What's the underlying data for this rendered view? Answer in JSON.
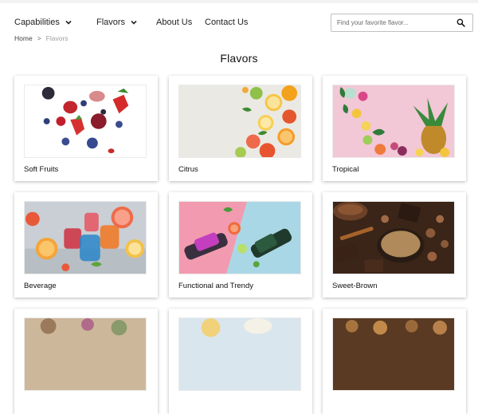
{
  "nav": {
    "capabilities": "Capabilities",
    "flavors": "Flavors",
    "about": "About Us",
    "contact": "Contact Us"
  },
  "search": {
    "placeholder": "Find your favorite flavor..."
  },
  "breadcrumb": {
    "home": "Home",
    "separator": ">",
    "current": "Flavors"
  },
  "page": {
    "title": "Flavors"
  },
  "cards": [
    {
      "label": "Soft Fruits"
    },
    {
      "label": "Citrus"
    },
    {
      "label": "Tropical"
    },
    {
      "label": "Beverage"
    },
    {
      "label": "Functional and Trendy"
    },
    {
      "label": "Sweet-Brown"
    },
    {
      "label": ""
    },
    {
      "label": ""
    },
    {
      "label": ""
    }
  ]
}
